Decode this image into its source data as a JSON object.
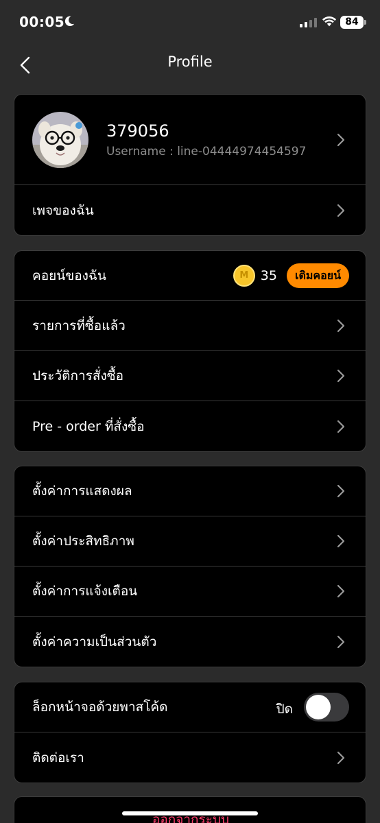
{
  "status_bar": {
    "time": "00:05",
    "battery": "84"
  },
  "nav": {
    "title": "Profile"
  },
  "profile": {
    "name": "379056",
    "username": "Username : line-04444974454597"
  },
  "my_page": {
    "label": "เพจของฉัน"
  },
  "coins": {
    "label": "คอยน์ของฉัน",
    "coin_letter": "M",
    "count": "35",
    "topup_label": "เติมคอยน์"
  },
  "shop_items": [
    {
      "label": "รายการที่ซื้อแล้ว"
    },
    {
      "label": "ประวัติการสั่งซื้อ"
    },
    {
      "label": "Pre - order ที่สั่งซื้อ"
    }
  ],
  "settings_items": [
    {
      "label": "ตั้งค่าการแสดงผล"
    },
    {
      "label": "ตั้งค่าประสิทธิภาพ"
    },
    {
      "label": "ตั้งค่าการแจ้งเตือน"
    },
    {
      "label": "ตั้งค่าความเป็นส่วนตัว"
    }
  ],
  "passcode": {
    "label": "ล็อกหน้าจอด้วยพาสโค้ด",
    "state": "ปิด"
  },
  "contact": {
    "label": "ติดต่อเรา"
  },
  "logout": {
    "label": "ออกจากระบบ"
  },
  "colors": {
    "accent": "#ff8a00",
    "background": "#2b2b2b",
    "card": "#000000",
    "logout": "#ff3b6b"
  }
}
